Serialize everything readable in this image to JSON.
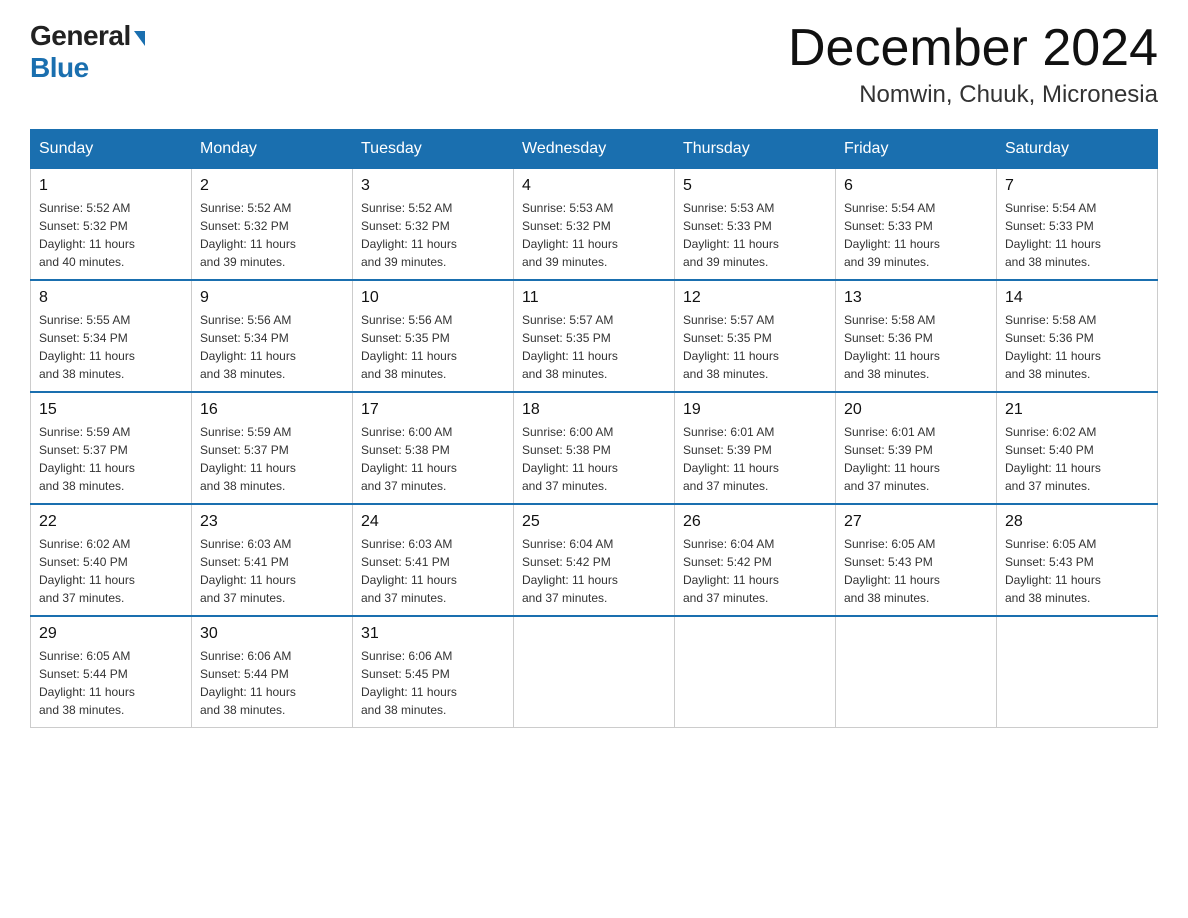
{
  "logo": {
    "general": "General",
    "blue": "Blue"
  },
  "title": "December 2024",
  "location": "Nomwin, Chuuk, Micronesia",
  "days_of_week": [
    "Sunday",
    "Monday",
    "Tuesday",
    "Wednesday",
    "Thursday",
    "Friday",
    "Saturday"
  ],
  "weeks": [
    [
      {
        "day": "1",
        "sunrise": "5:52 AM",
        "sunset": "5:32 PM",
        "daylight": "11 hours and 40 minutes."
      },
      {
        "day": "2",
        "sunrise": "5:52 AM",
        "sunset": "5:32 PM",
        "daylight": "11 hours and 39 minutes."
      },
      {
        "day": "3",
        "sunrise": "5:52 AM",
        "sunset": "5:32 PM",
        "daylight": "11 hours and 39 minutes."
      },
      {
        "day": "4",
        "sunrise": "5:53 AM",
        "sunset": "5:32 PM",
        "daylight": "11 hours and 39 minutes."
      },
      {
        "day": "5",
        "sunrise": "5:53 AM",
        "sunset": "5:33 PM",
        "daylight": "11 hours and 39 minutes."
      },
      {
        "day": "6",
        "sunrise": "5:54 AM",
        "sunset": "5:33 PM",
        "daylight": "11 hours and 39 minutes."
      },
      {
        "day": "7",
        "sunrise": "5:54 AM",
        "sunset": "5:33 PM",
        "daylight": "11 hours and 38 minutes."
      }
    ],
    [
      {
        "day": "8",
        "sunrise": "5:55 AM",
        "sunset": "5:34 PM",
        "daylight": "11 hours and 38 minutes."
      },
      {
        "day": "9",
        "sunrise": "5:56 AM",
        "sunset": "5:34 PM",
        "daylight": "11 hours and 38 minutes."
      },
      {
        "day": "10",
        "sunrise": "5:56 AM",
        "sunset": "5:35 PM",
        "daylight": "11 hours and 38 minutes."
      },
      {
        "day": "11",
        "sunrise": "5:57 AM",
        "sunset": "5:35 PM",
        "daylight": "11 hours and 38 minutes."
      },
      {
        "day": "12",
        "sunrise": "5:57 AM",
        "sunset": "5:35 PM",
        "daylight": "11 hours and 38 minutes."
      },
      {
        "day": "13",
        "sunrise": "5:58 AM",
        "sunset": "5:36 PM",
        "daylight": "11 hours and 38 minutes."
      },
      {
        "day": "14",
        "sunrise": "5:58 AM",
        "sunset": "5:36 PM",
        "daylight": "11 hours and 38 minutes."
      }
    ],
    [
      {
        "day": "15",
        "sunrise": "5:59 AM",
        "sunset": "5:37 PM",
        "daylight": "11 hours and 38 minutes."
      },
      {
        "day": "16",
        "sunrise": "5:59 AM",
        "sunset": "5:37 PM",
        "daylight": "11 hours and 38 minutes."
      },
      {
        "day": "17",
        "sunrise": "6:00 AM",
        "sunset": "5:38 PM",
        "daylight": "11 hours and 37 minutes."
      },
      {
        "day": "18",
        "sunrise": "6:00 AM",
        "sunset": "5:38 PM",
        "daylight": "11 hours and 37 minutes."
      },
      {
        "day": "19",
        "sunrise": "6:01 AM",
        "sunset": "5:39 PM",
        "daylight": "11 hours and 37 minutes."
      },
      {
        "day": "20",
        "sunrise": "6:01 AM",
        "sunset": "5:39 PM",
        "daylight": "11 hours and 37 minutes."
      },
      {
        "day": "21",
        "sunrise": "6:02 AM",
        "sunset": "5:40 PM",
        "daylight": "11 hours and 37 minutes."
      }
    ],
    [
      {
        "day": "22",
        "sunrise": "6:02 AM",
        "sunset": "5:40 PM",
        "daylight": "11 hours and 37 minutes."
      },
      {
        "day": "23",
        "sunrise": "6:03 AM",
        "sunset": "5:41 PM",
        "daylight": "11 hours and 37 minutes."
      },
      {
        "day": "24",
        "sunrise": "6:03 AM",
        "sunset": "5:41 PM",
        "daylight": "11 hours and 37 minutes."
      },
      {
        "day": "25",
        "sunrise": "6:04 AM",
        "sunset": "5:42 PM",
        "daylight": "11 hours and 37 minutes."
      },
      {
        "day": "26",
        "sunrise": "6:04 AM",
        "sunset": "5:42 PM",
        "daylight": "11 hours and 37 minutes."
      },
      {
        "day": "27",
        "sunrise": "6:05 AM",
        "sunset": "5:43 PM",
        "daylight": "11 hours and 38 minutes."
      },
      {
        "day": "28",
        "sunrise": "6:05 AM",
        "sunset": "5:43 PM",
        "daylight": "11 hours and 38 minutes."
      }
    ],
    [
      {
        "day": "29",
        "sunrise": "6:05 AM",
        "sunset": "5:44 PM",
        "daylight": "11 hours and 38 minutes."
      },
      {
        "day": "30",
        "sunrise": "6:06 AM",
        "sunset": "5:44 PM",
        "daylight": "11 hours and 38 minutes."
      },
      {
        "day": "31",
        "sunrise": "6:06 AM",
        "sunset": "5:45 PM",
        "daylight": "11 hours and 38 minutes."
      },
      null,
      null,
      null,
      null
    ]
  ],
  "labels": {
    "sunrise": "Sunrise:",
    "sunset": "Sunset:",
    "daylight": "Daylight:"
  },
  "colors": {
    "header_bg": "#1a6faf",
    "header_text": "#ffffff",
    "border": "#cccccc"
  }
}
